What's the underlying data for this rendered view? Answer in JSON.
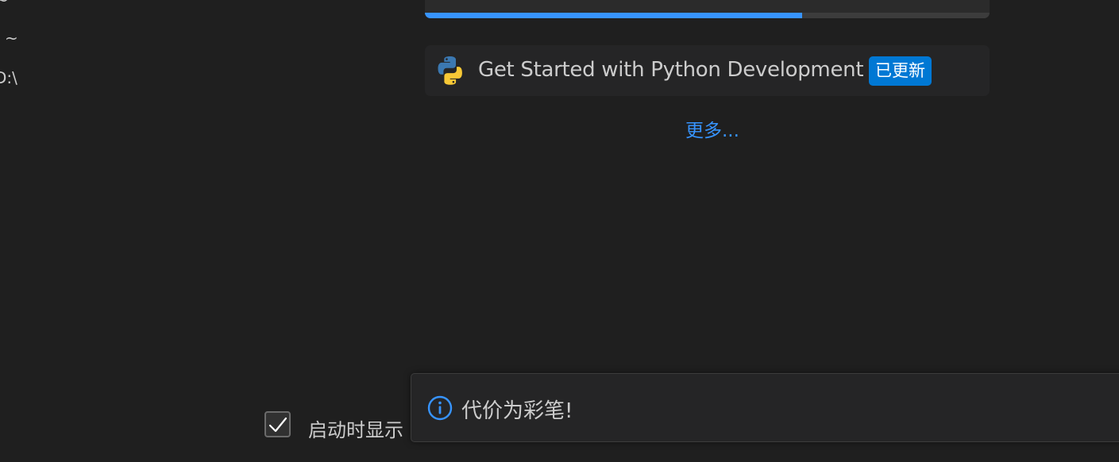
{
  "recent_list": {
    "items": [
      "~",
      "~",
      "D:\\"
    ]
  },
  "walkthroughs": {
    "partial_card": {
      "title": "",
      "progress_percent": 66.8
    },
    "python_card": {
      "title": "Get Started with Python Development",
      "badge": "已更新",
      "icon": "python-logo-icon"
    },
    "more_link": "更多..."
  },
  "startup": {
    "label": "启动时显示",
    "checked": true
  },
  "notification": {
    "icon": "info-icon",
    "message": "代价为彩笔!"
  },
  "colors": {
    "background": "#1f1f1f",
    "card": "#252526",
    "accent": "#3794ff",
    "badge": "#0078d4",
    "text": "#cccccc"
  }
}
